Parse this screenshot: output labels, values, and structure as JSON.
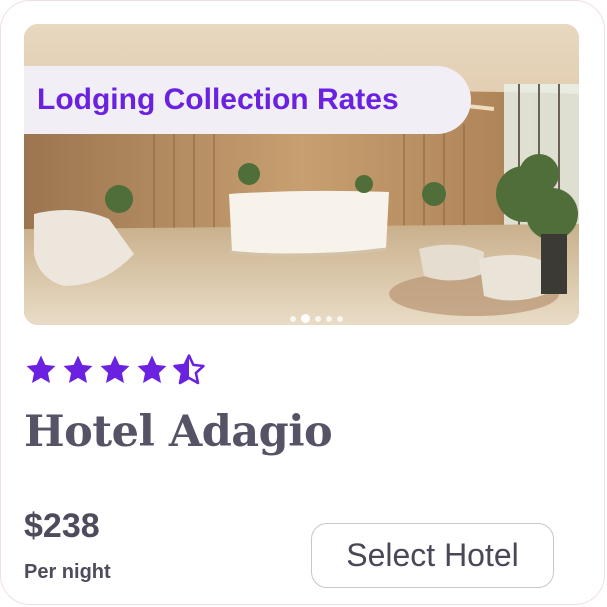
{
  "colors": {
    "accent": "#6a22e0",
    "badge_background": "#f1eef5",
    "text_dark": "#4e4b5c",
    "title_color": "#565366",
    "border": "#c9c5cf"
  },
  "hotel": {
    "collection_badge": "Lodging Collection Rates",
    "name": "Hotel Adagio",
    "price": "$238",
    "price_unit": "Per night",
    "rating": 4.5,
    "rating_max": 5
  },
  "carousel": {
    "slide_count": 5,
    "active_index": 1
  },
  "actions": {
    "select_label": "Select Hotel"
  },
  "icons": {
    "full_star": "star-filled-icon",
    "half_star": "star-half-icon"
  }
}
